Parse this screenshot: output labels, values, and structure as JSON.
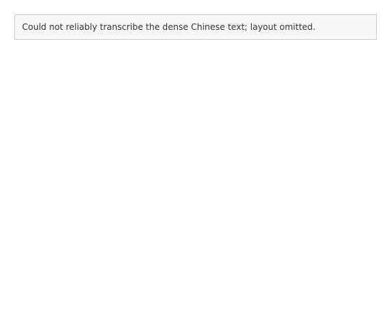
{
  "note": "Could not reliably transcribe the dense Chinese text; layout omitted."
}
